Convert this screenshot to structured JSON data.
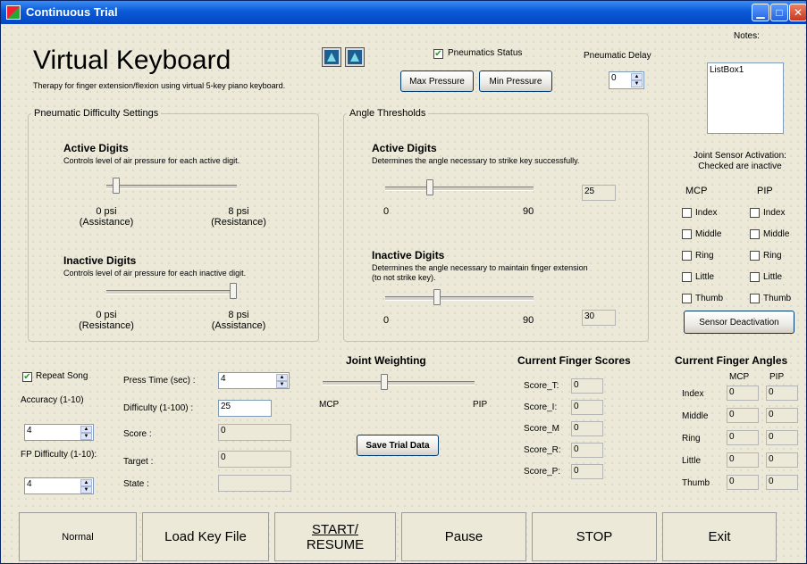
{
  "window": {
    "title": "Continuous Trial"
  },
  "header": {
    "title": "Virtual Keyboard",
    "subtitle": "Therapy for finger extension/flexion using virtual 5-key piano keyboard.",
    "pneumatics_status_label": "Pneumatics Status",
    "pneumatics_status_checked": true,
    "pneumatic_delay_label": "Pneumatic Delay",
    "pneumatic_delay_value": "0",
    "max_pressure_label": "Max Pressure",
    "min_pressure_label": "Min Pressure"
  },
  "notes": {
    "label": "Notes:",
    "listbox_text": "ListBox1"
  },
  "pneumatic": {
    "group_label": "Pneumatic Difficulty Settings",
    "active_title": "Active Digits",
    "active_desc": "Controls level of air pressure for each active digit.",
    "active_min": "0 psi",
    "active_min_sub": "(Assistance)",
    "active_max": "8 psi",
    "active_max_sub": "(Resistance)",
    "active_level": 0.05,
    "inactive_title": "Inactive Digits",
    "inactive_desc": "Controls level of air pressure for each inactive digit.",
    "inactive_min": "0 psi",
    "inactive_min_sub": "(Resistance)",
    "inactive_max": "8 psi",
    "inactive_max_sub": "(Assistance)",
    "inactive_level": 1.0
  },
  "angle": {
    "group_label": "Angle Thresholds",
    "active_title": "Active Digits",
    "active_desc": "Determines the angle necessary to strike key successfully.",
    "active_min": "0",
    "active_max": "90",
    "active_value": "25",
    "inactive_title": "Inactive Digits",
    "inactive_desc1": "Determines the angle necessary to maintain finger extension",
    "inactive_desc2": "(to not strike key).",
    "inactive_min": "0",
    "inactive_max": "90",
    "inactive_value": "30"
  },
  "sensor": {
    "heading1": "Joint Sensor Activation:",
    "heading2": "Checked are inactive",
    "mcp_label": "MCP",
    "pip_label": "PIP",
    "fingers": [
      "Index",
      "Middle",
      "Ring",
      "Little",
      "Thumb"
    ],
    "deactivation_button": "Sensor Deactivation"
  },
  "trial": {
    "repeat_song_label": "Repeat Song",
    "repeat_song_checked": true,
    "accuracy_label": "Accuracy (1-10)",
    "accuracy_value": "4",
    "fp_difficulty_label": "FP Difficulty (1-10):",
    "fp_difficulty_value": "4",
    "press_time_label": "Press Time (sec) :",
    "press_time_value": "4",
    "difficulty_label": "Difficulty (1-100) :",
    "difficulty_value": "25",
    "score_label": "Score :",
    "score_value": "0",
    "target_label": "Target :",
    "target_value": "0",
    "state_label": "State :",
    "state_value": ""
  },
  "joint_weighting": {
    "label": "Joint Weighting",
    "min": "MCP",
    "max": "PIP",
    "level": 0.4,
    "save_button": "Save Trial Data"
  },
  "scores": {
    "heading": "Current Finger Scores",
    "items": [
      {
        "label": "Score_T:",
        "value": "0"
      },
      {
        "label": "Score_I:",
        "value": "0"
      },
      {
        "label": "Score_M",
        "value": "0"
      },
      {
        "label": "Score_R:",
        "value": "0"
      },
      {
        "label": "Score_P:",
        "value": "0"
      }
    ]
  },
  "angles": {
    "heading": "Current Finger Angles",
    "mcp_label": "MCP",
    "pip_label": "PIP",
    "rows": [
      {
        "label": "Index",
        "mcp": "0",
        "pip": "0"
      },
      {
        "label": "Middle",
        "mcp": "0",
        "pip": "0"
      },
      {
        "label": "Ring",
        "mcp": "0",
        "pip": "0"
      },
      {
        "label": "Little",
        "mcp": "0",
        "pip": "0"
      },
      {
        "label": "Thumb",
        "mcp": "0",
        "pip": "0"
      }
    ]
  },
  "bottom_buttons": {
    "normal": "Normal",
    "load_key_file": "Load Key File",
    "start_line1": "START/",
    "start_line2": "RESUME",
    "pause": "Pause",
    "stop": "STOP",
    "exit": "Exit"
  }
}
